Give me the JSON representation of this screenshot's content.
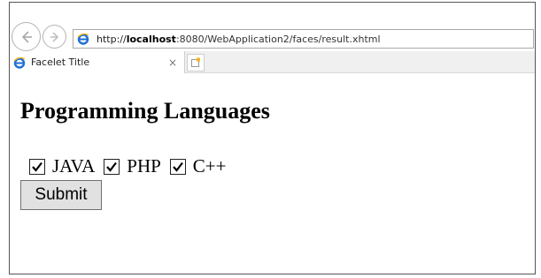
{
  "browser": {
    "url_prefix": "http://",
    "url_host": "localhost",
    "url_rest": ":8080/WebApplication2/faces/result.xhtml",
    "tab_title": "Facelet Title",
    "tab_close": "×",
    "icons": [
      "back-arrow-icon",
      "forward-arrow-icon",
      "ie-icon",
      "close-icon",
      "new-tab-icon"
    ]
  },
  "page": {
    "heading": "Programming Languages",
    "options": [
      {
        "label": "JAVA",
        "checked": true
      },
      {
        "label": "PHP",
        "checked": true
      },
      {
        "label": "C++",
        "checked": true
      }
    ],
    "submit_label": "Submit"
  },
  "colors": {
    "ie_blue": "#1e6fd9",
    "ie_ring": "#f2b417"
  }
}
